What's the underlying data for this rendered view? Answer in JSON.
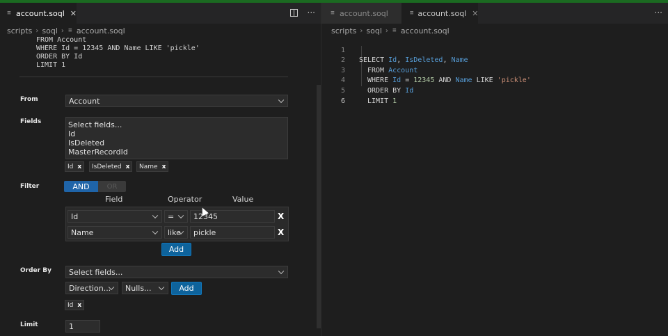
{
  "left": {
    "tab": {
      "label": "account.soql",
      "close": "✕"
    },
    "actions": {
      "more": "···"
    },
    "breadcrumb": [
      "scripts",
      "soql",
      "account.soql"
    ],
    "query_preview": [
      "FROM Account",
      "WHERE Id = 12345 AND Name LIKE 'pickle'",
      "ORDER BY Id",
      "LIMIT 1"
    ],
    "from": {
      "label": "From",
      "value": "Account"
    },
    "fields": {
      "label": "Fields",
      "list": [
        "Select fields...",
        "Id",
        "IsDeleted",
        "MasterRecordId"
      ],
      "pills": [
        "Id",
        "IsDeleted",
        "Name"
      ]
    },
    "filter": {
      "label": "Filter",
      "toggle_on": "AND",
      "toggle_off": "OR",
      "headers": {
        "field": "Field",
        "operator": "Operator",
        "value": "Value"
      },
      "rows": [
        {
          "field": "Id",
          "operator": "=",
          "value": "12345"
        },
        {
          "field": "Name",
          "operator": "like",
          "value": "pickle"
        }
      ],
      "remove": "X",
      "add": "Add"
    },
    "order_by": {
      "label": "Order By",
      "fields_placeholder": "Select fields...",
      "direction": "Direction...",
      "nulls": "Nulls...",
      "add": "Add",
      "pills": [
        "Id"
      ]
    },
    "limit": {
      "label": "Limit",
      "value": "1"
    },
    "pill_remove": "x"
  },
  "right": {
    "tabs": [
      {
        "label": "account.soql",
        "close": ""
      },
      {
        "label": "account.soql",
        "close": "✕"
      }
    ],
    "more": "···",
    "breadcrumb": [
      "scripts",
      "soql",
      "account.soql"
    ],
    "line_numbers": [
      "1",
      "2",
      "3",
      "4",
      "5",
      "6"
    ],
    "code": {
      "l1": {
        "kw": "SELECT ",
        "a": "Id",
        "s1": ", ",
        "b": "IsDeleted",
        "s2": ", ",
        "c": "Name"
      },
      "l2": {
        "kw": "FROM ",
        "a": "Account"
      },
      "l3": {
        "kw": "WHERE ",
        "a": "Id",
        "op": " = ",
        "num": "12345",
        "and": " AND ",
        "b": "Name",
        "like": " LIKE ",
        "str": "'pickle'"
      },
      "l4": {
        "kw": "ORDER BY ",
        "a": "Id"
      },
      "l5": {
        "kw": "LIMIT ",
        "num": "1"
      }
    }
  },
  "colors": {
    "accent": "#0e639c",
    "keyword_id": "#569cd6",
    "string": "#ce9178",
    "topbar": "#1b6a21"
  }
}
